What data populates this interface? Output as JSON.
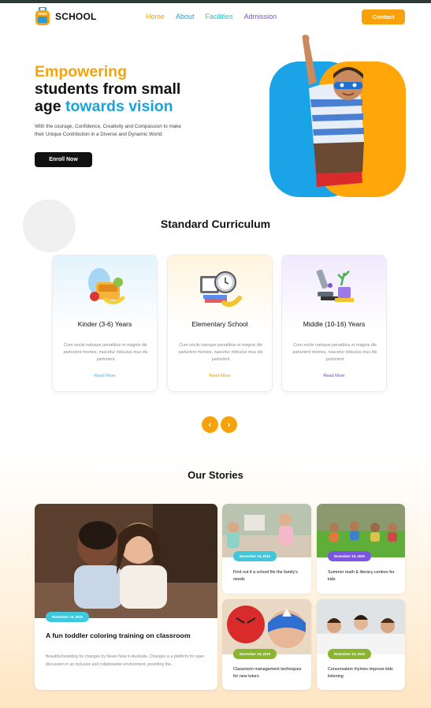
{
  "header": {
    "logo_text": "SCHOOL",
    "nav": [
      "Home",
      "About",
      "Facilities",
      "Admission"
    ],
    "nav_colors": [
      "#f7a20d",
      "#1aa3dc",
      "#27bcc4",
      "#7a4fd6"
    ],
    "contact_label": "Contact"
  },
  "hero": {
    "title_line1": "Empowering",
    "title_line2": "students from small",
    "title_line3a": "age ",
    "title_line3b": "towards vision",
    "description": "With the courage, Confidence, Creativity and Compassion to make their Unique Contribution in a Diverse and Dynamic World.",
    "enroll_label": "Enroll Now"
  },
  "curriculum": {
    "title": "Standard Curriculum",
    "cards": [
      {
        "title": "Kinder (3-6) Years",
        "desc": "Cum sociis natoque penatibus et magnis dis parturient montes, nascetur ridiculus mus dis parturient",
        "more": "Read More",
        "color": "#4cb2e6",
        "bg": "#e3f3fc",
        "icon": "fruit-lunchbox-icon"
      },
      {
        "title": "Elementary School",
        "desc": "Cum sociis natoque penatibus et magnis dis parturient montes, nascetur ridiculus mus dis parturient",
        "more": "Read More",
        "color": "#e79b0b",
        "bg": "#fff4de",
        "icon": "alarm-clock-books-icon"
      },
      {
        "title": "Middle (10-16) Years",
        "desc": "Cum sociis natoque penatibus et magnis dis parturient montes, nascetur ridiculus mus dis parturient",
        "more": "Read More",
        "color": "#7a3fd1",
        "bg": "#f0e9fd",
        "icon": "microscope-icon"
      }
    ],
    "prev_icon": "‹",
    "next_icon": "›"
  },
  "stories": {
    "title": "Our Stories",
    "featured": {
      "date": "November 19, 2019",
      "badge_color": "#3fc8dc",
      "title": "A fun toddler coloring training on classroom",
      "desc": "Beautiful branding for changes by Never Now in Australia. Changes is a platform for open discussion in an inclusive and collaborative environment, providing the..."
    },
    "items": [
      {
        "date": "November 19, 2019",
        "badge_color": "#3fc8dc",
        "title": "Find out if a school fits the family's needs"
      },
      {
        "date": "November 19, 2019",
        "badge_color": "#7a55e6",
        "title": "Summer math & literacy centres for kids"
      },
      {
        "date": "November 19, 2019",
        "badge_color": "#8ab52e",
        "title": "Classroom management techniques for new tutors"
      },
      {
        "date": "November 19, 2019",
        "badge_color": "#8ab52e",
        "title": "Conversation rhymes improve kids listening"
      }
    ]
  }
}
